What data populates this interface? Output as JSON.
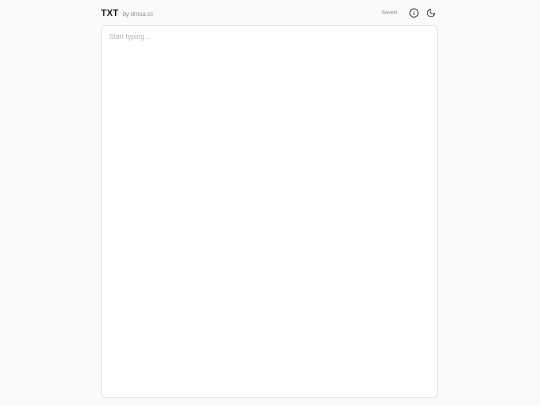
{
  "header": {
    "title": "TXT",
    "byline": "by drosa.cc",
    "status": "Saved",
    "info_icon": "info-icon",
    "theme_icon": "moon-icon"
  },
  "editor": {
    "value": "",
    "placeholder": "Start typing..."
  },
  "colors": {
    "background": "#fafafa",
    "editor_background": "#ffffff",
    "border": "#e4e4e4",
    "title": "#111111",
    "muted": "#8a8a8a"
  }
}
